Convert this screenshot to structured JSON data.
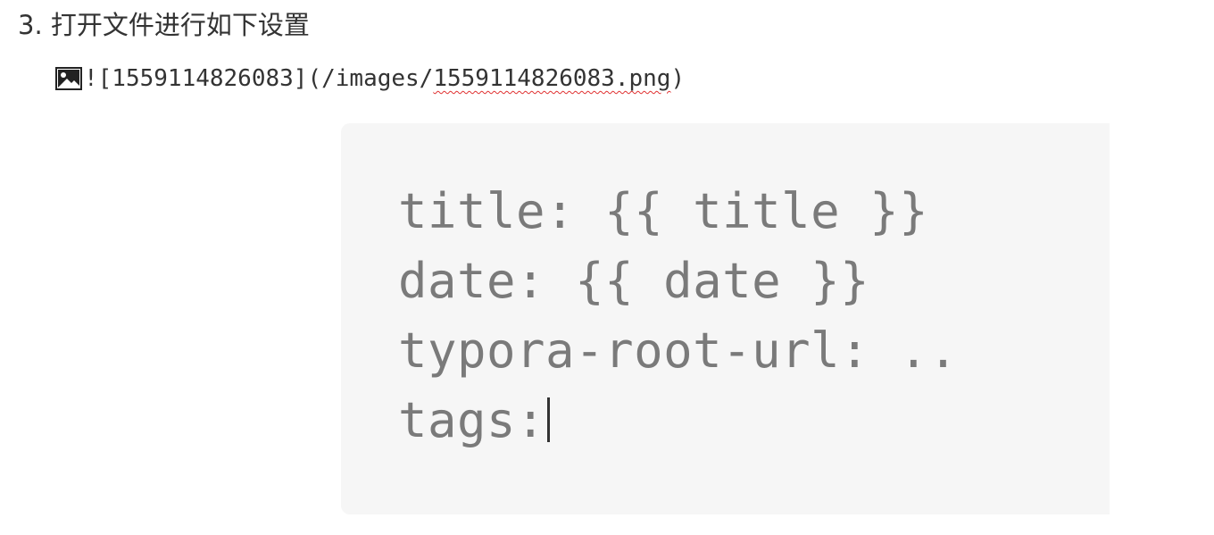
{
  "heading": {
    "text": "3. 打开文件进行如下设置"
  },
  "image_markdown": {
    "icon": "image-icon",
    "prefix": "![1559114826083](/images/",
    "filename": "1559114826083.png",
    "suffix": ")"
  },
  "code_block": {
    "lines": [
      "title: {{ title }}",
      "date: {{ date }}",
      "typora-root-url: ..",
      "tags:"
    ]
  },
  "colors": {
    "code_background": "#f6f6f6",
    "code_text": "#7a7a7a",
    "spellcheck_underline": "#e03131"
  }
}
